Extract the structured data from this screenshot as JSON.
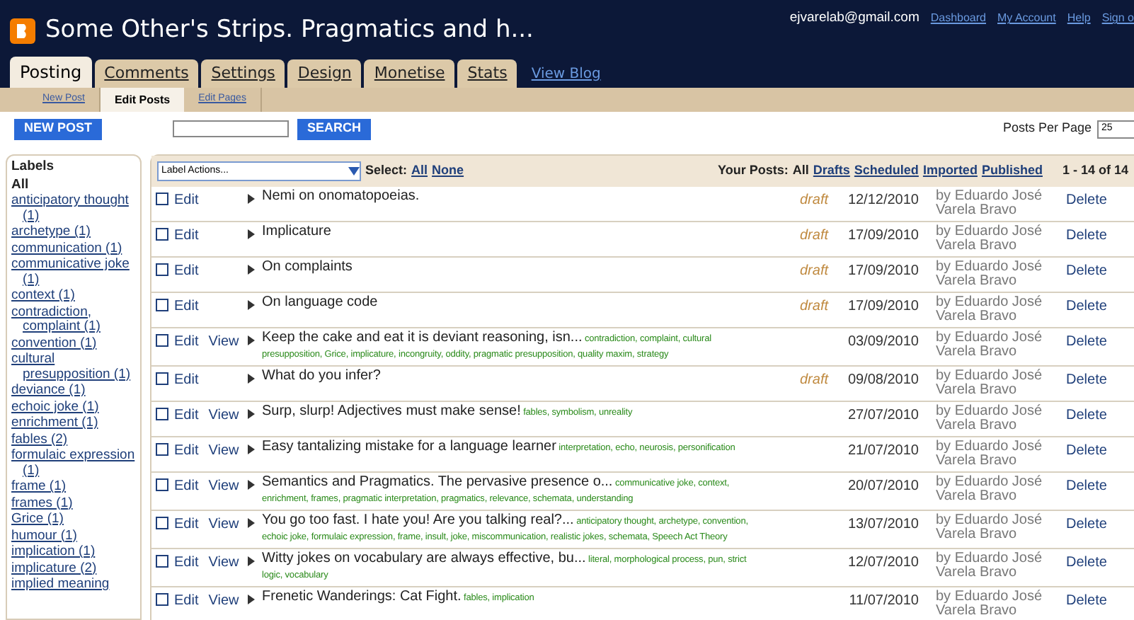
{
  "header": {
    "title": "Some Other's Strips. Pragmatics and h...",
    "email": "ejvarelab@gmail.com",
    "links": [
      "Dashboard",
      "My Account",
      "Help",
      "Sign o"
    ]
  },
  "tabs": [
    {
      "label": "Posting",
      "selected": true
    },
    {
      "label": "Comments",
      "selected": false
    },
    {
      "label": "Settings",
      "selected": false
    },
    {
      "label": "Design",
      "selected": false
    },
    {
      "label": "Monetise",
      "selected": false
    },
    {
      "label": "Stats",
      "selected": false
    }
  ],
  "view_blog": "View Blog",
  "subtabs": [
    {
      "label": "New Post",
      "selected": false
    },
    {
      "label": "Edit Posts",
      "selected": true
    },
    {
      "label": "Edit Pages",
      "selected": false
    }
  ],
  "toolbar": {
    "new_post": "NEW POST",
    "search_button": "SEARCH",
    "per_page_label": "Posts Per Page",
    "per_page_value": "25"
  },
  "labels": {
    "heading": "Labels",
    "items": [
      {
        "label": "All",
        "selected": true
      },
      {
        "label": "anticipatory thought (1)",
        "selected": false
      },
      {
        "label": "archetype (1)",
        "selected": false
      },
      {
        "label": "communication (1)",
        "selected": false
      },
      {
        "label": "communicative joke (1)",
        "selected": false
      },
      {
        "label": "context (1)",
        "selected": false
      },
      {
        "label": "contradiction, complaint (1)",
        "selected": false
      },
      {
        "label": "convention (1)",
        "selected": false
      },
      {
        "label": "cultural presupposition (1)",
        "selected": false
      },
      {
        "label": "deviance (1)",
        "selected": false
      },
      {
        "label": "echoic joke (1)",
        "selected": false
      },
      {
        "label": "enrichment (1)",
        "selected": false
      },
      {
        "label": "fables (2)",
        "selected": false
      },
      {
        "label": "formulaic expression (1)",
        "selected": false
      },
      {
        "label": "frame (1)",
        "selected": false
      },
      {
        "label": "frames (1)",
        "selected": false
      },
      {
        "label": "Grice (1)",
        "selected": false
      },
      {
        "label": "humour (1)",
        "selected": false
      },
      {
        "label": "implication (1)",
        "selected": false
      },
      {
        "label": "implicature (2)",
        "selected": false
      },
      {
        "label": "implied meaning",
        "selected": false
      }
    ]
  },
  "filter_bar": {
    "label_actions": "Label Actions...",
    "select_label": "Select:",
    "select_links": [
      "All",
      "None"
    ],
    "your_posts_label": "Your Posts:",
    "filters": [
      {
        "label": "All",
        "selected": true
      },
      {
        "label": "Drafts",
        "selected": false
      },
      {
        "label": "Scheduled",
        "selected": false
      },
      {
        "label": "Imported",
        "selected": false
      },
      {
        "label": "Published",
        "selected": false
      }
    ],
    "range": "1 - 14 of 14"
  },
  "posts": [
    {
      "checked": false,
      "actions": [
        "Edit"
      ],
      "title": "Nemi on onomatopoeias.",
      "status": "draft",
      "date": "12/12/2010",
      "author": "by Eduardo José Varela Bravo",
      "delete": "Delete"
    },
    {
      "checked": false,
      "actions": [
        "Edit"
      ],
      "title": "Implicature",
      "status": "draft",
      "date": "17/09/2010",
      "author": "by Eduardo José Varela Bravo",
      "delete": "Delete"
    },
    {
      "checked": false,
      "actions": [
        "Edit"
      ],
      "title": "On complaints",
      "status": "draft",
      "date": "17/09/2010",
      "author": "by Eduardo José Varela Bravo",
      "delete": "Delete"
    },
    {
      "checked": false,
      "actions": [
        "Edit"
      ],
      "title": "On language code",
      "status": "draft",
      "date": "17/09/2010",
      "author": "by Eduardo José Varela Bravo",
      "delete": "Delete"
    },
    {
      "checked": false,
      "actions": [
        "Edit",
        "View"
      ],
      "title": "Keep the cake and eat it is deviant reasoning, isn...",
      "tags": "contradiction, complaint, cultural presupposition, Grice, implicature, incongruity, oddity, pragmatic presupposition, quality maxim, strategy",
      "date": "03/09/2010",
      "author": "by Eduardo José Varela Bravo",
      "delete": "Delete"
    },
    {
      "checked": false,
      "actions": [
        "Edit"
      ],
      "title": "What do you infer?",
      "status": "draft",
      "date": "09/08/2010",
      "author": "by Eduardo José Varela Bravo",
      "delete": "Delete"
    },
    {
      "checked": false,
      "actions": [
        "Edit",
        "View"
      ],
      "title": "Surp, slurp! Adjectives must make sense!",
      "tags": "fables, symbolism, unreality",
      "date": "27/07/2010",
      "author": "by Eduardo José Varela Bravo",
      "delete": "Delete"
    },
    {
      "checked": false,
      "actions": [
        "Edit",
        "View"
      ],
      "title": "Easy tantalizing mistake for a language learner",
      "tags": "interpretation, echo, neurosis, personification",
      "date": "21/07/2010",
      "author": "by Eduardo José Varela Bravo",
      "delete": "Delete"
    },
    {
      "checked": false,
      "actions": [
        "Edit",
        "View"
      ],
      "title": "Semantics and Pragmatics. The pervasive presence o...",
      "tags": "communicative joke, context, enrichment, frames, pragmatic interpretation, pragmatics, relevance, schemata, understanding",
      "date": "20/07/2010",
      "author": "by Eduardo José Varela Bravo",
      "delete": "Delete"
    },
    {
      "checked": false,
      "actions": [
        "Edit",
        "View"
      ],
      "title": "You go too fast. I hate you! Are you talking real?...",
      "tags": "anticipatory thought, archetype, convention, echoic joke, formulaic expression, frame, insult, joke, miscommunication, realistic jokes, schemata, Speech Act Theory",
      "date": "13/07/2010",
      "author": "by Eduardo José Varela Bravo",
      "delete": "Delete"
    },
    {
      "checked": false,
      "actions": [
        "Edit",
        "View"
      ],
      "title": "Witty jokes on vocabulary are always effective, bu...",
      "tags": "literal, morphological process, pun, strict logic, vocabulary",
      "date": "12/07/2010",
      "author": "by Eduardo José Varela Bravo",
      "delete": "Delete"
    },
    {
      "checked": false,
      "actions": [
        "Edit",
        "View"
      ],
      "title": "Frenetic Wanderings: Cat Fight.",
      "tags": "fables, implication",
      "date": "11/07/2010",
      "author": "by Eduardo José Varela Bravo",
      "delete": "Delete"
    }
  ]
}
